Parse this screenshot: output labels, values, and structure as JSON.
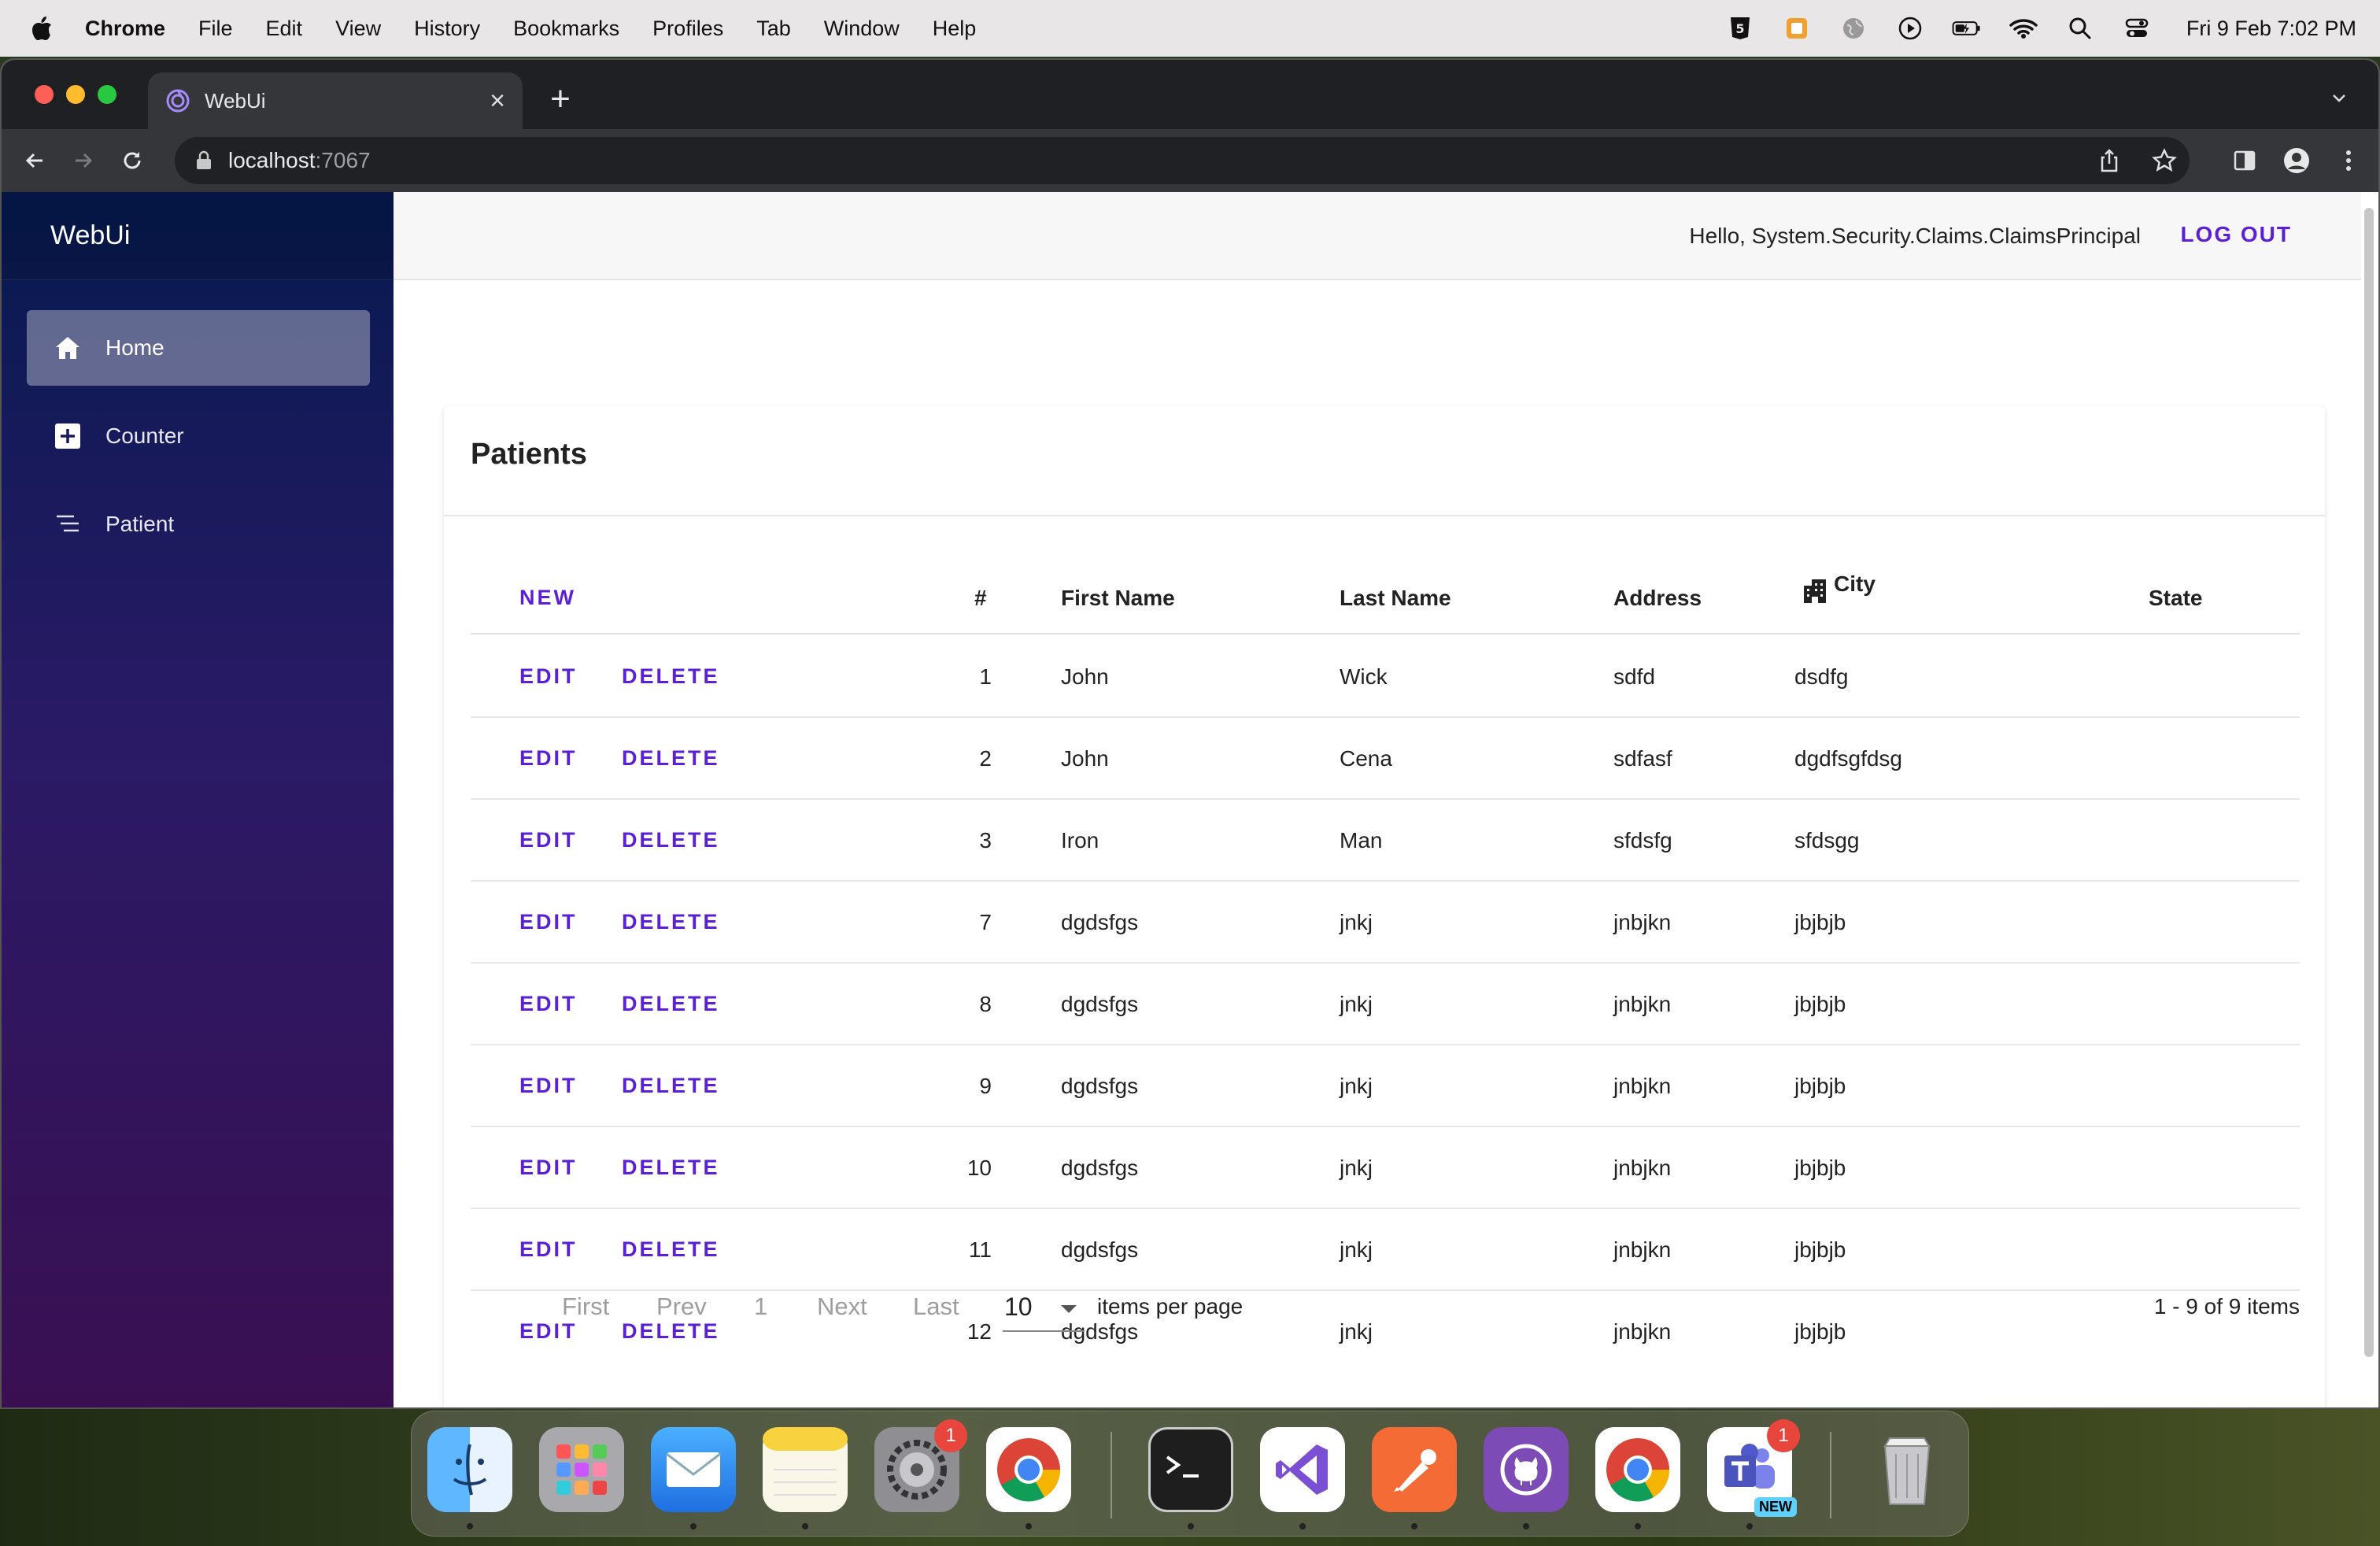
{
  "menubar": {
    "app": "Chrome",
    "items": [
      "File",
      "Edit",
      "View",
      "History",
      "Bookmarks",
      "Profiles",
      "Tab",
      "Window",
      "Help"
    ],
    "clock": "Fri 9 Feb  7:02 PM"
  },
  "browser": {
    "tab_title": "WebUi",
    "url_host": "localhost",
    "url_port": ":7067"
  },
  "app": {
    "brand": "WebUi",
    "nav": [
      {
        "label": "Home"
      },
      {
        "label": "Counter"
      },
      {
        "label": "Patient"
      }
    ],
    "greeting": "Hello, System.Security.Claims.ClaimsPrincipal",
    "logout": "LOG OUT"
  },
  "patients": {
    "title": "Patients",
    "new_label": "NEW",
    "edit_label": "EDIT",
    "delete_label": "DELETE",
    "columns": [
      "#",
      "First Name",
      "Last Name",
      "Address",
      "City",
      "State"
    ],
    "rows": [
      {
        "id": "1",
        "first": "John",
        "last": "Wick",
        "address": "sdfd",
        "city": "dsdfg",
        "state": ""
      },
      {
        "id": "2",
        "first": "John",
        "last": "Cena",
        "address": "sdfasf",
        "city": "dgdfsgfdsg",
        "state": ""
      },
      {
        "id": "3",
        "first": "Iron",
        "last": "Man",
        "address": "sfdsfg",
        "city": "sfdsgg",
        "state": ""
      },
      {
        "id": "7",
        "first": "dgdsfgs",
        "last": "jnkj",
        "address": "jnbjkn",
        "city": "jbjbjb",
        "state": ""
      },
      {
        "id": "8",
        "first": "dgdsfgs",
        "last": "jnkj",
        "address": "jnbjkn",
        "city": "jbjbjb",
        "state": ""
      },
      {
        "id": "9",
        "first": "dgdsfgs",
        "last": "jnkj",
        "address": "jnbjkn",
        "city": "jbjbjb",
        "state": ""
      },
      {
        "id": "10",
        "first": "dgdsfgs",
        "last": "jnkj",
        "address": "jnbjkn",
        "city": "jbjbjb",
        "state": ""
      },
      {
        "id": "11",
        "first": "dgdsfgs",
        "last": "jnkj",
        "address": "jnbjkn",
        "city": "jbjbjb",
        "state": ""
      },
      {
        "id": "12",
        "first": "dgdsfgs",
        "last": "jnkj",
        "address": "jnbjkn",
        "city": "jbjbjb",
        "state": ""
      }
    ],
    "pager": {
      "first": "First",
      "prev": "Prev",
      "page": "1",
      "next": "Next",
      "last": "Last",
      "per_page": "10",
      "per_page_label": "items per page",
      "summary": "1 - 9 of 9 items"
    }
  },
  "dock": {
    "apps": [
      "finder-icon",
      "launchpad-icon",
      "mail-icon",
      "notes-icon",
      "system-settings-icon",
      "chrome-icon",
      "terminal-icon",
      "visual-studio-icon",
      "postman-icon",
      "github-desktop-icon",
      "chrome-icon",
      "teams-icon",
      "trash-icon"
    ],
    "settings_badge": "1",
    "teams_badge": "1",
    "teams_new": "NEW"
  },
  "colors": {
    "accent": "#5b1fd6",
    "sidebar_top": "#061a50",
    "sidebar_bottom": "#3a0f52"
  }
}
